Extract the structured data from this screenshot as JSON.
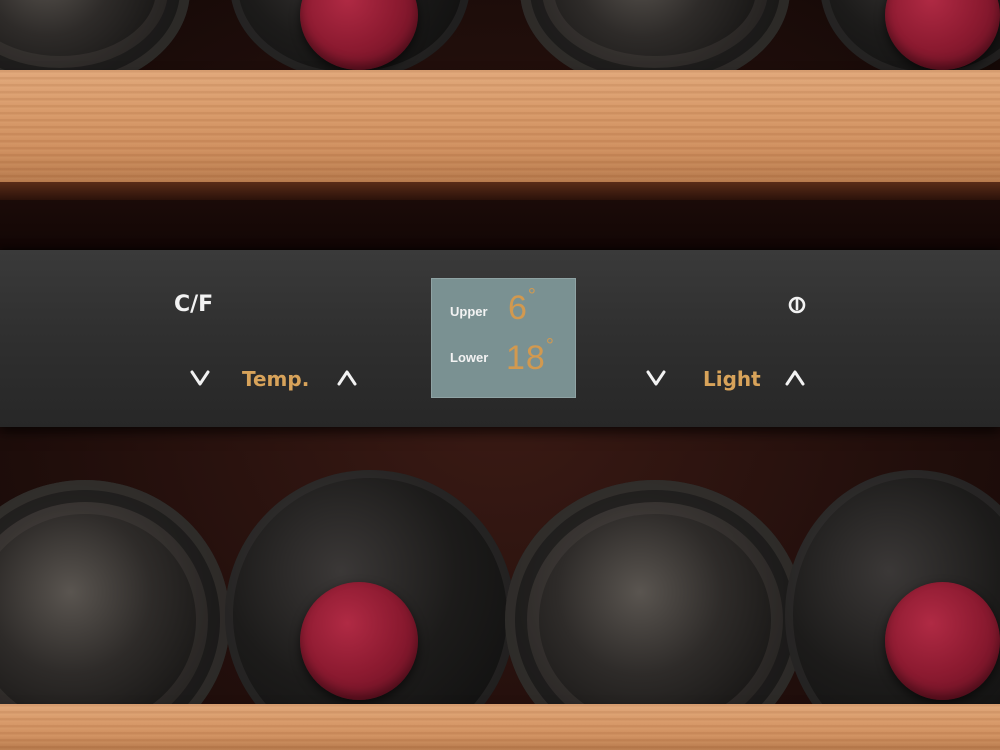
{
  "panel": {
    "unit_toggle_label": "C/F",
    "temp_label": "Temp.",
    "light_label": "Light",
    "display": {
      "upper_label": "Upper",
      "upper_value": "6",
      "lower_label": "Lower",
      "lower_value": "18",
      "degree_symbol": "°"
    },
    "icons": {
      "temp_down": "chevron-down-icon",
      "temp_up": "chevron-up-icon",
      "light_down": "chevron-down-icon",
      "light_up": "chevron-up-icon",
      "power": "power-icon"
    }
  },
  "colors": {
    "panel_bg": "#2f2f2f",
    "accent_gold": "#d8a35a",
    "display_bg": "#7a9192",
    "display_digits": "#d2994f",
    "button_text": "#f2f2f2",
    "cap_red": "#8c1a30",
    "shelf_wood": "#d89a6a"
  }
}
